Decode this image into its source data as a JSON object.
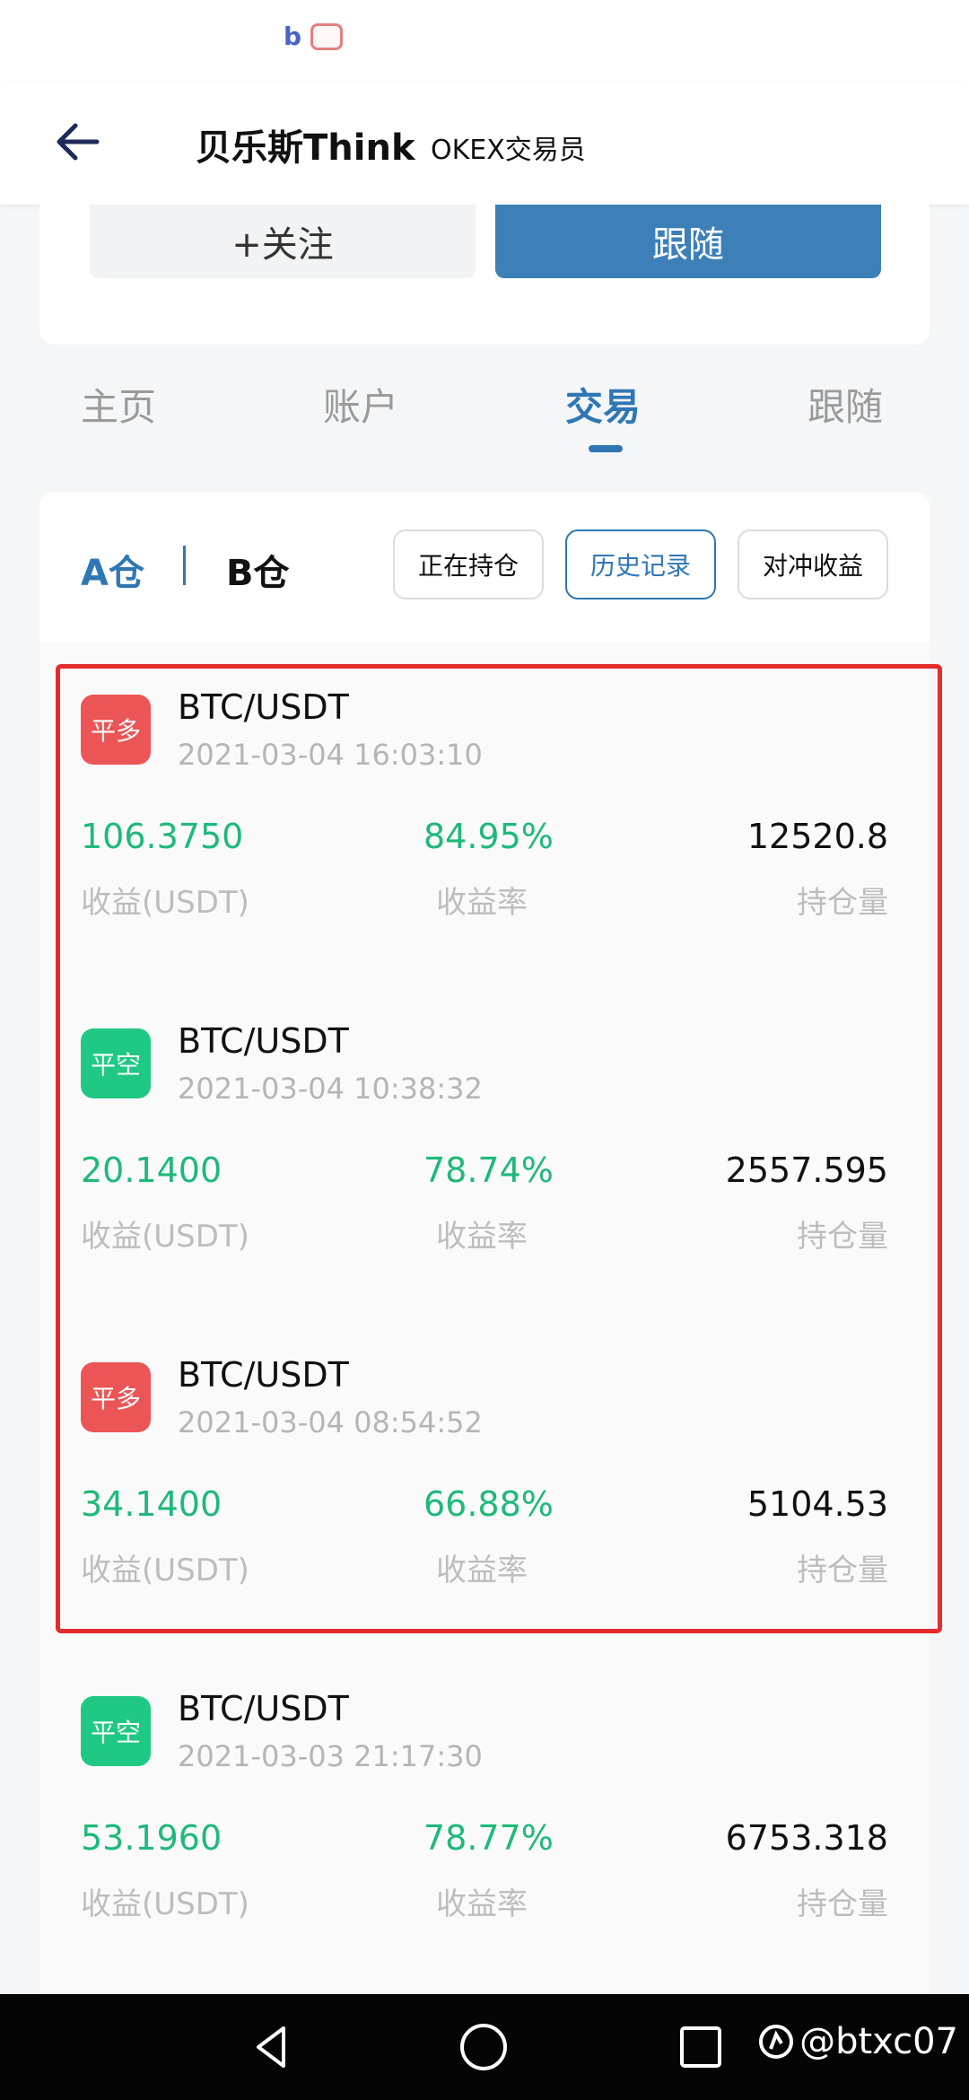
{
  "header": {
    "title": "贝乐斯Think",
    "subtitle": "OKEX交易员"
  },
  "actions": {
    "follow_label": "+关注",
    "copy_label": "跟随"
  },
  "tabs": [
    {
      "label": "主页"
    },
    {
      "label": "账户"
    },
    {
      "label": "交易"
    },
    {
      "label": "跟随"
    }
  ],
  "active_tab": "交易",
  "segments": {
    "a": "A仓",
    "b": "B仓"
  },
  "filters": [
    {
      "label": "正在持仓"
    },
    {
      "label": "历史记录"
    },
    {
      "label": "对冲收益"
    }
  ],
  "active_filter": "历史记录",
  "labels": {
    "profit": "收益(USDT)",
    "rate": "收益率",
    "position": "持仓量"
  },
  "trades": [
    {
      "badge": "平多",
      "pair": "BTC/USDT",
      "time": "2021-03-04 16:03:10",
      "profit": "106.3750",
      "rate": "84.95%",
      "position": "12520.8"
    },
    {
      "badge": "平空",
      "pair": "BTC/USDT",
      "time": "2021-03-04 10:38:32",
      "profit": "20.1400",
      "rate": "78.74%",
      "position": "2557.595"
    },
    {
      "badge": "平多",
      "pair": "BTC/USDT",
      "time": "2021-03-04 08:54:52",
      "profit": "34.1400",
      "rate": "66.88%",
      "position": "5104.53"
    },
    {
      "badge": "平空",
      "pair": "BTC/USDT",
      "time": "2021-03-03 21:17:30",
      "profit": "53.1960",
      "rate": "78.77%",
      "position": "6753.318"
    }
  ],
  "watermark": "@btxc07",
  "colors": {
    "accent": "#2f77b4",
    "long_badge": "#ec5555",
    "short_badge": "#1fc984",
    "positive": "#1fb97a"
  }
}
